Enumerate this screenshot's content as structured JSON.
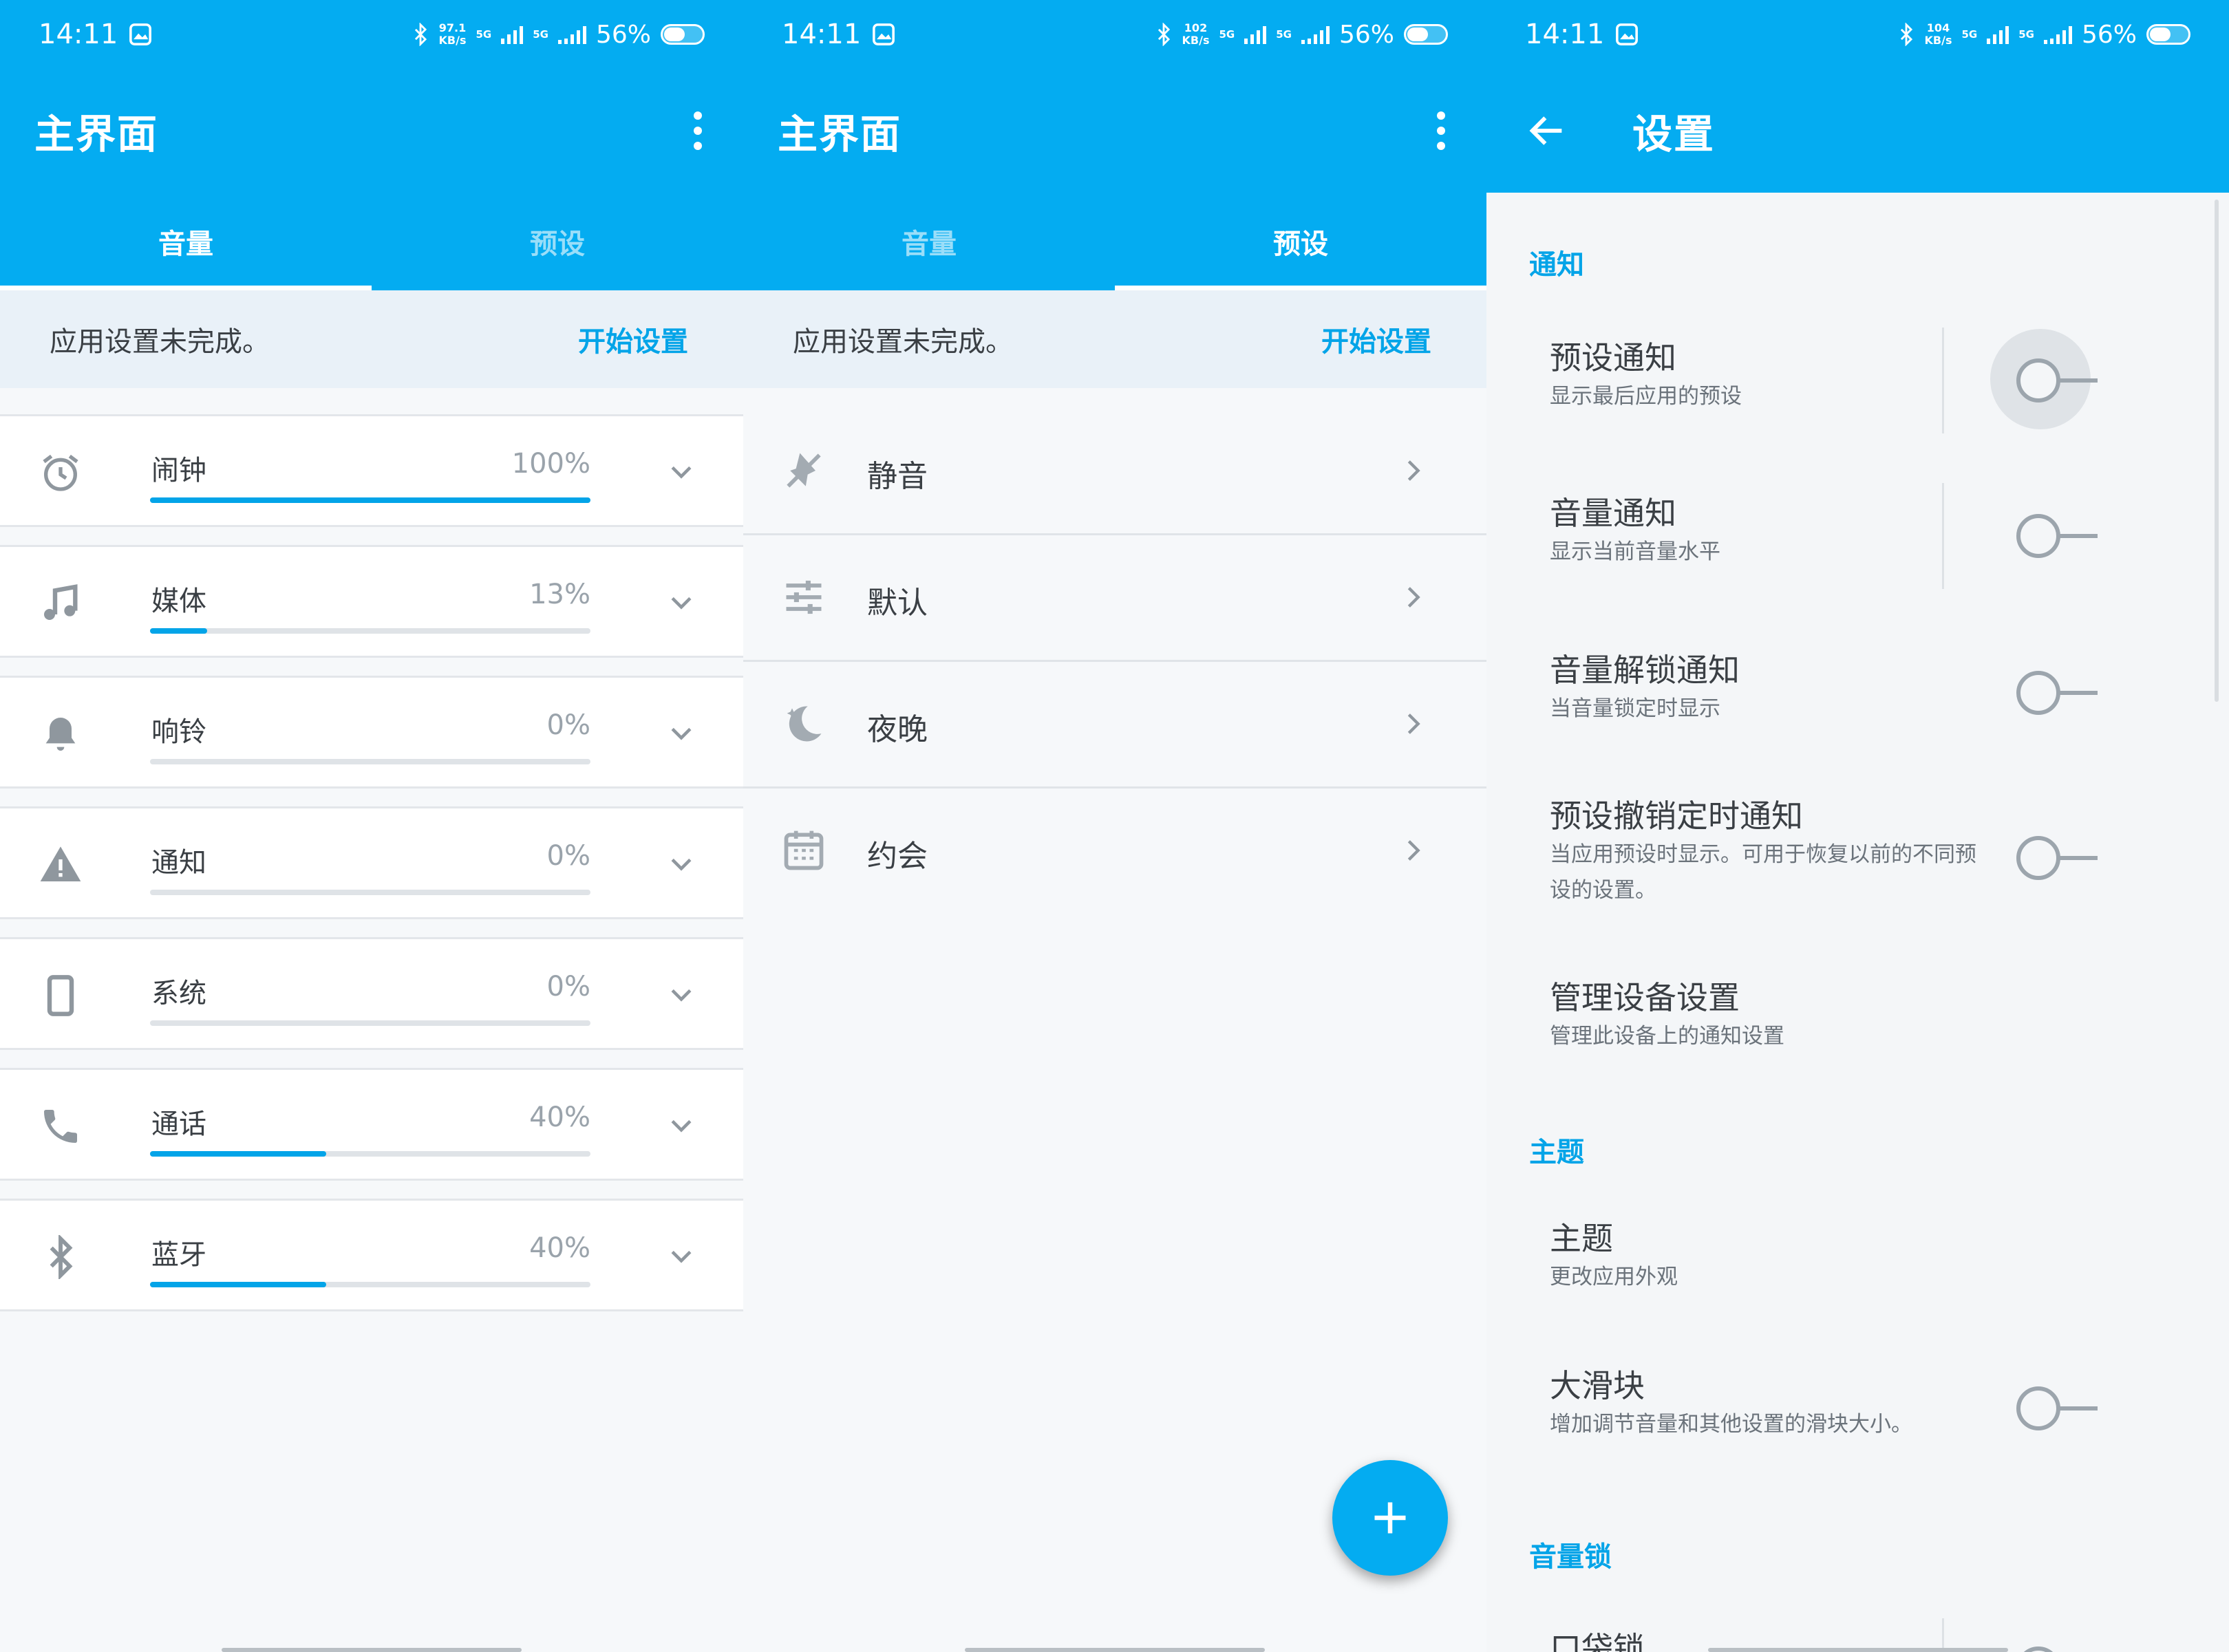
{
  "status": {
    "time": "14:11",
    "speed_p1": [
      "97.1",
      "KB/s"
    ],
    "speed_p2": [
      "102",
      "KB/s"
    ],
    "speed_p3": [
      "104",
      "KB/s"
    ],
    "net": "5G",
    "battery": "56%",
    "icons": [
      "gallery-icon",
      "bluetooth-icon",
      "signal-icon",
      "battery-icon"
    ]
  },
  "main": {
    "title": "主界面",
    "tabs": [
      "音量",
      "预设"
    ],
    "banner_msg": "应用设置未完成。",
    "banner_btn": "开始设置"
  },
  "volumes": [
    {
      "label": "闹钟",
      "pct": "100%",
      "value": 100,
      "icon": "alarm-icon"
    },
    {
      "label": "媒体",
      "pct": "13%",
      "value": 13,
      "icon": "music-note-icon"
    },
    {
      "label": "响铃",
      "pct": "0%",
      "value": 0,
      "icon": "bell-icon"
    },
    {
      "label": "通知",
      "pct": "0%",
      "value": 0,
      "icon": "warning-icon"
    },
    {
      "label": "系统",
      "pct": "0%",
      "value": 0,
      "icon": "phone-device-icon"
    },
    {
      "label": "通话",
      "pct": "40%",
      "value": 40,
      "icon": "phone-call-icon"
    },
    {
      "label": "蓝牙",
      "pct": "40%",
      "value": 40,
      "icon": "bluetooth-icon"
    }
  ],
  "presets": [
    {
      "label": "静音",
      "icon": "mute-icon"
    },
    {
      "label": "默认",
      "icon": "sliders-icon"
    },
    {
      "label": "夜晚",
      "icon": "moon-icon"
    },
    {
      "label": "约会",
      "icon": "calendar-icon"
    }
  ],
  "settings": {
    "title": "设置",
    "sections": {
      "notify": "通知",
      "theme": "主题",
      "lock": "音量锁"
    },
    "items": {
      "preset_notify": {
        "title": "预设通知",
        "sub": "显示最后应用的预设"
      },
      "volume_notify": {
        "title": "音量通知",
        "sub": "显示当前音量水平"
      },
      "unlock_notify": {
        "title": "音量解锁通知",
        "sub": "当音量锁定时显示"
      },
      "revoke_notify": {
        "title": "预设撤销定时通知",
        "sub": "当应用预设时显示。可用于恢复以前的不同预设的设置。"
      },
      "manage_notify": {
        "title": "管理设备设置",
        "sub": "管理此设备上的通知设置"
      },
      "theme": {
        "title": "主题",
        "sub": "更改应用外观"
      },
      "big_slider": {
        "title": "大滑块",
        "sub": "增加调节音量和其他设置的滑块大小。"
      },
      "pocket_lock": {
        "title": "口袋锁"
      }
    }
  },
  "colors": {
    "primary": "#04acf1",
    "accent": "#03a4e8",
    "bg": "#f6f8fa"
  }
}
